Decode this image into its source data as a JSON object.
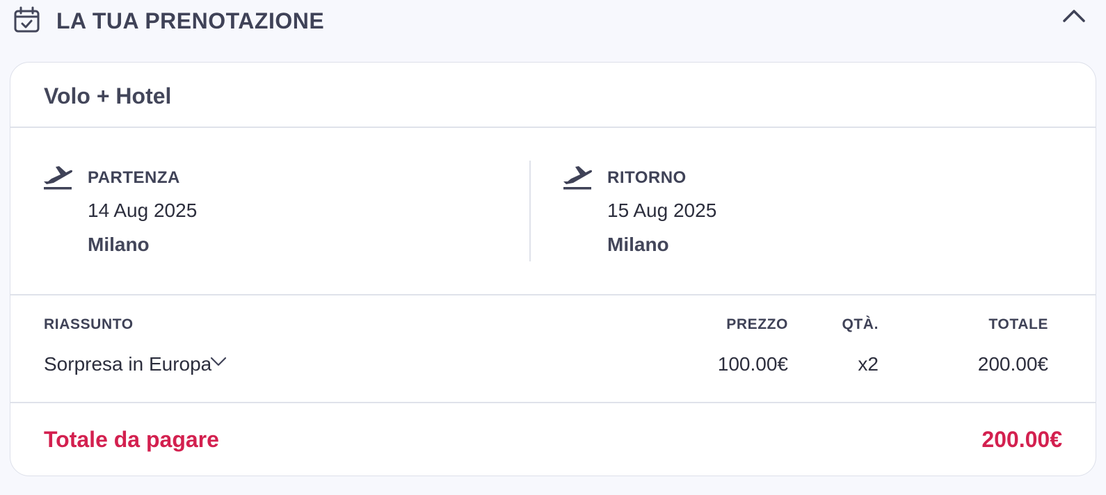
{
  "header": {
    "title": "LA TUA PRENOTAZIONE",
    "icon": "calendar-check-icon",
    "collapse_icon": "chevron-up-icon"
  },
  "card": {
    "title": "Volo + Hotel",
    "departure": {
      "icon": "plane-takeoff-icon",
      "label": "PARTENZA",
      "date": "14 Aug 2025",
      "city": "Milano"
    },
    "return": {
      "icon": "plane-takeoff-icon",
      "label": "RITORNO",
      "date": "15 Aug 2025",
      "city": "Milano"
    },
    "summary": {
      "headers": {
        "item": "RIASSUNTO",
        "price": "PREZZO",
        "qty": "QTÀ.",
        "total": "TOTALE"
      },
      "rows": [
        {
          "name": "Sorpresa in Europa",
          "price": "100.00€",
          "qty": "x2",
          "total": "200.00€"
        }
      ]
    },
    "total": {
      "label": "Totale da pagare",
      "value": "200.00€"
    }
  },
  "colors": {
    "accent": "#d3204f",
    "text": "#3f4257",
    "background": "#f7f8fd",
    "border": "#dde0ea"
  }
}
